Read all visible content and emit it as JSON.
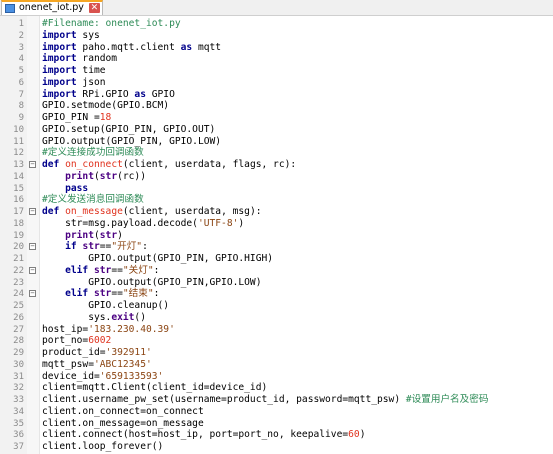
{
  "tab": {
    "filename": "onenet_iot.py"
  },
  "lines": [
    {
      "n": "1",
      "segs": [
        {
          "t": "#Filename: onenet_iot.py",
          "c": "cm"
        }
      ]
    },
    {
      "n": "2",
      "segs": [
        {
          "t": "import",
          "c": "kw"
        },
        {
          "t": " sys",
          "c": ""
        }
      ]
    },
    {
      "n": "3",
      "segs": [
        {
          "t": "import",
          "c": "kw"
        },
        {
          "t": " paho.mqtt.client ",
          "c": ""
        },
        {
          "t": "as",
          "c": "kw"
        },
        {
          "t": " mqtt",
          "c": ""
        }
      ]
    },
    {
      "n": "4",
      "segs": [
        {
          "t": "import",
          "c": "kw"
        },
        {
          "t": " random",
          "c": ""
        }
      ]
    },
    {
      "n": "5",
      "segs": [
        {
          "t": "import",
          "c": "kw"
        },
        {
          "t": " time",
          "c": ""
        }
      ]
    },
    {
      "n": "6",
      "segs": [
        {
          "t": "import",
          "c": "kw"
        },
        {
          "t": " json",
          "c": ""
        }
      ]
    },
    {
      "n": "7",
      "segs": [
        {
          "t": "import",
          "c": "kw"
        },
        {
          "t": " RPi.GPIO ",
          "c": ""
        },
        {
          "t": "as",
          "c": "kw"
        },
        {
          "t": " GPIO",
          "c": ""
        }
      ]
    },
    {
      "n": "8",
      "segs": [
        {
          "t": "GPIO.setmode(GPIO.BCM)",
          "c": ""
        }
      ]
    },
    {
      "n": "9",
      "segs": [
        {
          "t": "GPIO_PIN =",
          "c": ""
        },
        {
          "t": "18",
          "c": "nm"
        }
      ]
    },
    {
      "n": "10",
      "segs": [
        {
          "t": "GPIO.setup(GPIO_PIN, GPIO.OUT)",
          "c": ""
        }
      ]
    },
    {
      "n": "11",
      "segs": [
        {
          "t": "GPIO.output(GPIO_PIN, GPIO.LOW)",
          "c": ""
        }
      ]
    },
    {
      "n": "12",
      "segs": [
        {
          "t": "#定义连接成功回调函数",
          "c": "cm"
        }
      ]
    },
    {
      "n": "13",
      "fold": "−",
      "segs": [
        {
          "t": "def",
          "c": "kw"
        },
        {
          "t": " ",
          "c": ""
        },
        {
          "t": "on_connect",
          "c": "fn"
        },
        {
          "t": "(client, userdata, flags, rc):",
          "c": ""
        }
      ]
    },
    {
      "n": "14",
      "segs": [
        {
          "t": "    ",
          "c": ""
        },
        {
          "t": "print",
          "c": "bi"
        },
        {
          "t": "(",
          "c": ""
        },
        {
          "t": "str",
          "c": "bi"
        },
        {
          "t": "(rc))",
          "c": ""
        }
      ]
    },
    {
      "n": "15",
      "segs": [
        {
          "t": "    ",
          "c": ""
        },
        {
          "t": "pass",
          "c": "kw"
        }
      ]
    },
    {
      "n": "16",
      "segs": [
        {
          "t": "#定义发送消息回调函数",
          "c": "cm"
        }
      ]
    },
    {
      "n": "17",
      "fold": "−",
      "segs": [
        {
          "t": "def",
          "c": "kw"
        },
        {
          "t": " ",
          "c": ""
        },
        {
          "t": "on_message",
          "c": "fn"
        },
        {
          "t": "(client, userdata, msg):",
          "c": ""
        }
      ]
    },
    {
      "n": "18",
      "segs": [
        {
          "t": "    str=msg.payload.decode(",
          "c": ""
        },
        {
          "t": "'UTF-8'",
          "c": "st"
        },
        {
          "t": ")",
          "c": ""
        }
      ]
    },
    {
      "n": "19",
      "segs": [
        {
          "t": "    ",
          "c": ""
        },
        {
          "t": "print",
          "c": "bi"
        },
        {
          "t": "(",
          "c": ""
        },
        {
          "t": "str",
          "c": "bi"
        },
        {
          "t": ")",
          "c": ""
        }
      ]
    },
    {
      "n": "20",
      "fold": "−",
      "segs": [
        {
          "t": "    ",
          "c": ""
        },
        {
          "t": "if",
          "c": "kw"
        },
        {
          "t": " ",
          "c": ""
        },
        {
          "t": "str",
          "c": "bi"
        },
        {
          "t": "==",
          "c": ""
        },
        {
          "t": "\"开灯\"",
          "c": "st"
        },
        {
          "t": ":",
          "c": ""
        }
      ]
    },
    {
      "n": "21",
      "segs": [
        {
          "t": "        GPIO.output(GPIO_PIN, GPIO.HIGH)",
          "c": ""
        }
      ]
    },
    {
      "n": "22",
      "fold": "−",
      "segs": [
        {
          "t": "    ",
          "c": ""
        },
        {
          "t": "elif",
          "c": "kw"
        },
        {
          "t": " ",
          "c": ""
        },
        {
          "t": "str",
          "c": "bi"
        },
        {
          "t": "==",
          "c": ""
        },
        {
          "t": "\"关灯\"",
          "c": "st"
        },
        {
          "t": ":",
          "c": ""
        }
      ]
    },
    {
      "n": "23",
      "segs": [
        {
          "t": "        GPIO.output(GPIO_PIN,GPIO.LOW)",
          "c": ""
        }
      ]
    },
    {
      "n": "24",
      "fold": "−",
      "segs": [
        {
          "t": "    ",
          "c": ""
        },
        {
          "t": "elif",
          "c": "kw"
        },
        {
          "t": " ",
          "c": ""
        },
        {
          "t": "str",
          "c": "bi"
        },
        {
          "t": "==",
          "c": ""
        },
        {
          "t": "\"结束\"",
          "c": "st"
        },
        {
          "t": ":",
          "c": ""
        }
      ]
    },
    {
      "n": "25",
      "segs": [
        {
          "t": "        GPIO.cleanup()",
          "c": ""
        }
      ]
    },
    {
      "n": "26",
      "segs": [
        {
          "t": "        sys.",
          "c": ""
        },
        {
          "t": "exit",
          "c": "bi"
        },
        {
          "t": "()",
          "c": ""
        }
      ]
    },
    {
      "n": "27",
      "segs": [
        {
          "t": "host_ip=",
          "c": ""
        },
        {
          "t": "'183.230.40.39'",
          "c": "st"
        }
      ]
    },
    {
      "n": "28",
      "segs": [
        {
          "t": "port_no=",
          "c": ""
        },
        {
          "t": "6002",
          "c": "nm"
        }
      ]
    },
    {
      "n": "29",
      "segs": [
        {
          "t": "product_id=",
          "c": ""
        },
        {
          "t": "'392911'",
          "c": "st"
        }
      ]
    },
    {
      "n": "30",
      "segs": [
        {
          "t": "mqtt_psw=",
          "c": ""
        },
        {
          "t": "'ABC12345'",
          "c": "st"
        }
      ]
    },
    {
      "n": "31",
      "segs": [
        {
          "t": "device_id=",
          "c": ""
        },
        {
          "t": "'659133593'",
          "c": "st"
        }
      ]
    },
    {
      "n": "32",
      "segs": [
        {
          "t": "client=mqtt.Client(client_id=device_id)",
          "c": ""
        }
      ]
    },
    {
      "n": "33",
      "segs": [
        {
          "t": "client.username_pw_set(username=product_id, password=mqtt_psw) ",
          "c": ""
        },
        {
          "t": "#设置用户名及密码",
          "c": "cm"
        }
      ]
    },
    {
      "n": "34",
      "segs": [
        {
          "t": "client.on_connect=on_connect",
          "c": ""
        }
      ]
    },
    {
      "n": "35",
      "segs": [
        {
          "t": "client.on_message=on_message",
          "c": ""
        }
      ]
    },
    {
      "n": "36",
      "segs": [
        {
          "t": "client.connect(host=host_ip, port=port_no, keepalive=",
          "c": ""
        },
        {
          "t": "60",
          "c": "nm"
        },
        {
          "t": ")",
          "c": ""
        }
      ]
    },
    {
      "n": "37",
      "segs": [
        {
          "t": "client.loop_forever()",
          "c": ""
        }
      ]
    }
  ]
}
